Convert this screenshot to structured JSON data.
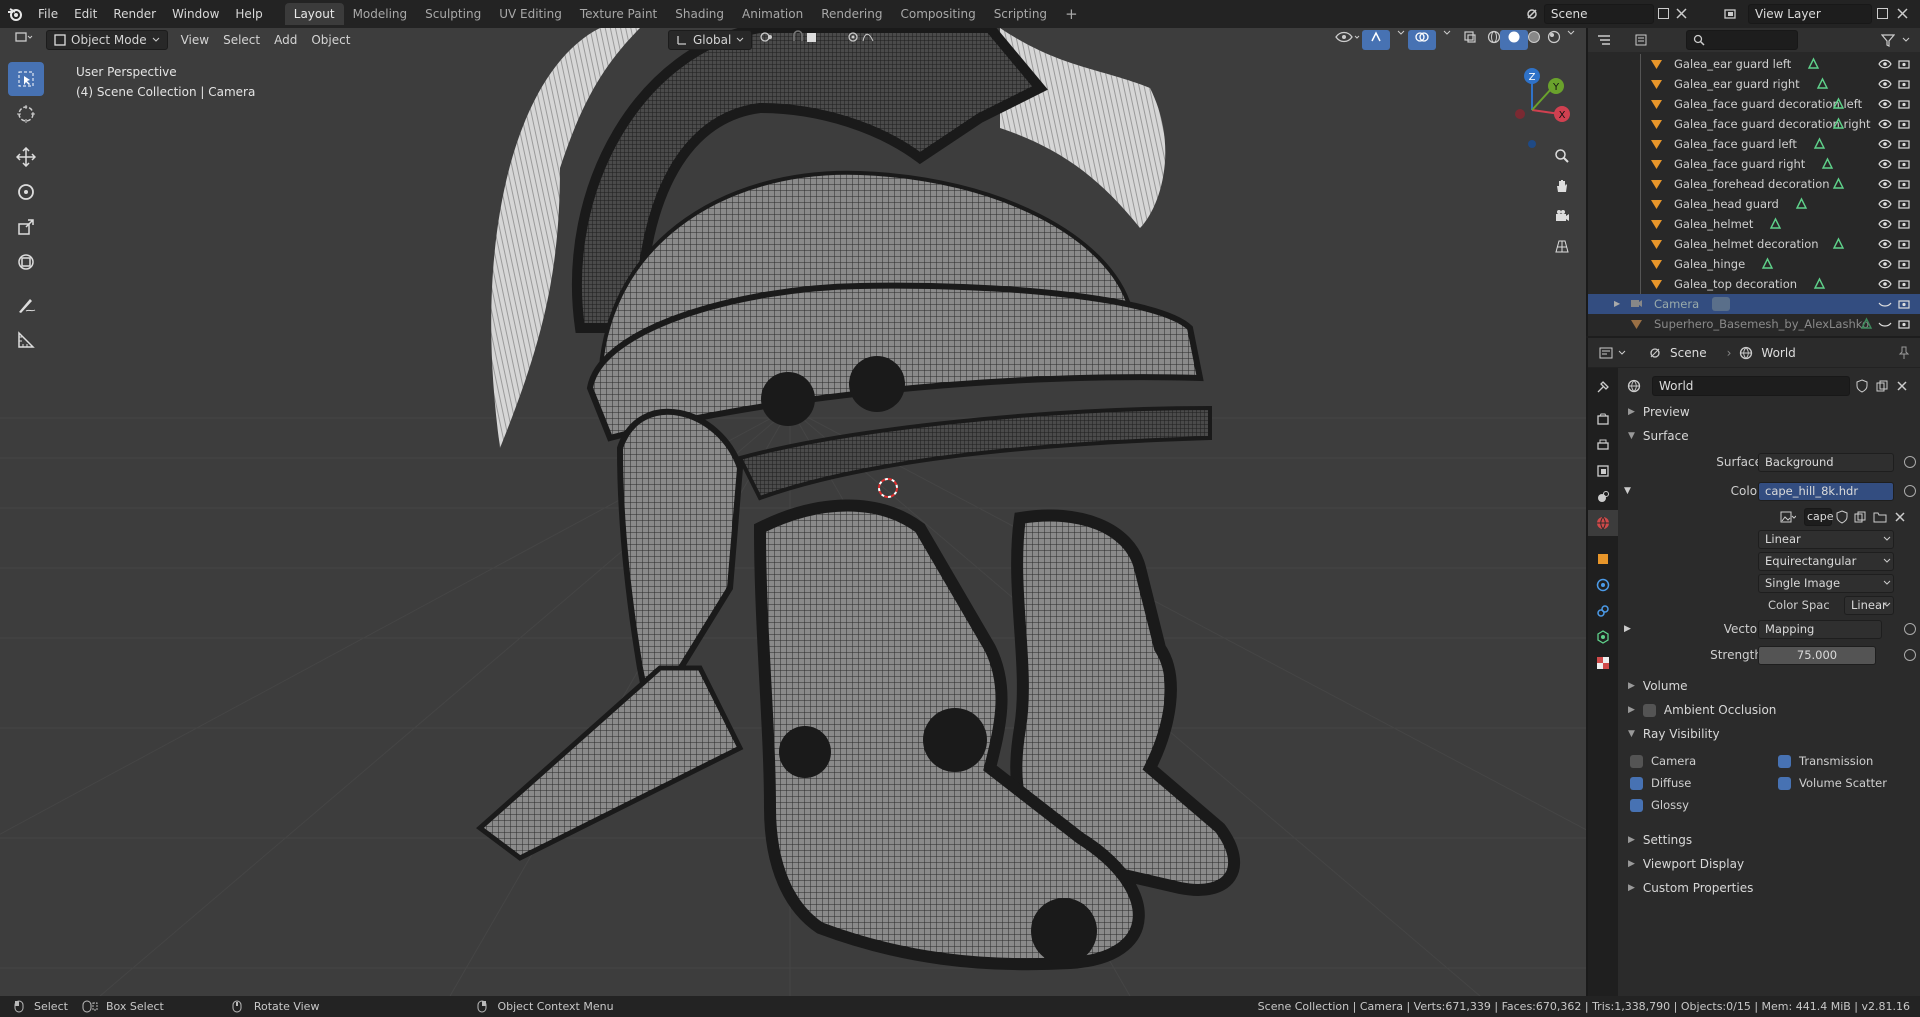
{
  "menus": [
    "File",
    "Edit",
    "Render",
    "Window",
    "Help"
  ],
  "workspaces": [
    "Layout",
    "Modeling",
    "Sculpting",
    "UV Editing",
    "Texture Paint",
    "Shading",
    "Animation",
    "Rendering",
    "Compositing",
    "Scripting"
  ],
  "active_workspace": "Layout",
  "scene_name": "Scene",
  "view_layer": "View Layer",
  "viewport": {
    "mode": "Object Mode",
    "menus": [
      "View",
      "Select",
      "Add",
      "Object"
    ],
    "orientation": "Global",
    "info_line1": "User Perspective",
    "info_line2": "(4) Scene Collection | Camera",
    "gizmo_axes": {
      "z": "Z",
      "y": "Y",
      "x": "X"
    }
  },
  "outliner": {
    "items": [
      {
        "name": "Galea_ear guard left"
      },
      {
        "name": "Galea_ear guard right"
      },
      {
        "name": "Galea_face guard decoration left"
      },
      {
        "name": "Galea_face guard decoration right"
      },
      {
        "name": "Galea_face guard left"
      },
      {
        "name": "Galea_face guard right"
      },
      {
        "name": "Galea_forehead decoration"
      },
      {
        "name": "Galea_head guard"
      },
      {
        "name": "Galea_helmet"
      },
      {
        "name": "Galea_helmet decoration"
      },
      {
        "name": "Galea_hinge"
      },
      {
        "name": "Galea_top decoration"
      }
    ],
    "camera": "Camera",
    "superhero": "Superhero_Basemesh_by_AlexLashko"
  },
  "properties": {
    "breadcrumb_scene": "Scene",
    "breadcrumb_world": "World",
    "world_name": "World",
    "sections": {
      "preview": "Preview",
      "surface": "Surface",
      "volume": "Volume",
      "ambient_occlusion": "Ambient Occlusion",
      "ray_visibility": "Ray Visibility",
      "settings": "Settings",
      "viewport_display": "Viewport Display",
      "custom_properties": "Custom Properties"
    },
    "surface_label": "Surface",
    "surface_value": "Background",
    "color_label": "Color",
    "color_value": "cape_hill_8k.hdr",
    "image_name": "cape",
    "interpolation": "Linear",
    "projection": "Equirectangular",
    "source": "Single Image",
    "color_space_label": "Color Spac",
    "color_space_value": "Linear",
    "vector_label": "Vector",
    "vector_value": "Mapping",
    "strength_label": "Strength",
    "strength_value": "75.000",
    "ray_visibility": {
      "camera": {
        "label": "Camera",
        "checked": false
      },
      "transmission": {
        "label": "Transmission",
        "checked": true
      },
      "diffuse": {
        "label": "Diffuse",
        "checked": true
      },
      "volume_scatter": {
        "label": "Volume Scatter",
        "checked": true
      },
      "glossy": {
        "label": "Glossy",
        "checked": true
      }
    }
  },
  "statusbar": {
    "select": "Select",
    "box_select": "Box Select",
    "rotate_view": "Rotate View",
    "context_menu": "Object Context Menu",
    "stats": "Scene Collection | Camera | Verts:671,339 | Faces:670,362 | Tris:1,338,790 | Objects:0/15 | Mem: 441.4 MiB | v2.81.16"
  },
  "colors": {
    "accent": "#4772b3",
    "selected_row": "#334d80",
    "object_orange": "#e8962a",
    "mesh_green": "#5fd18a"
  }
}
